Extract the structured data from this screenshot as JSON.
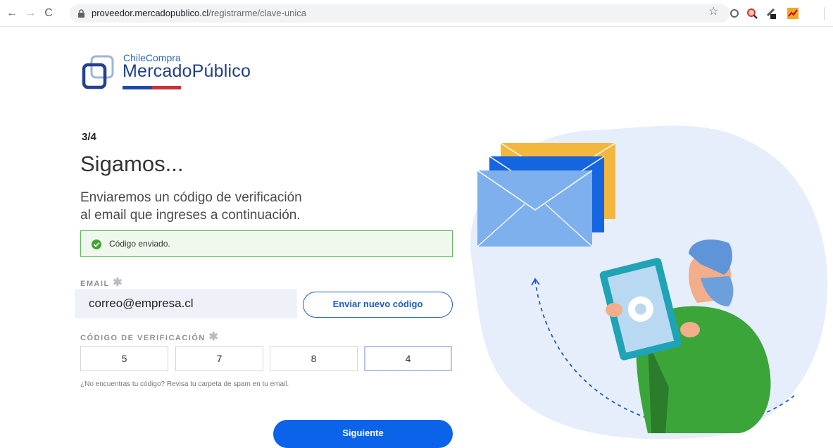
{
  "browser": {
    "url_host": "proveedor.mercadopublico.cl",
    "url_path": "/registrarme/clave-unica"
  },
  "logo": {
    "small": "ChileCompra",
    "big": "MercadoPúblico"
  },
  "form": {
    "step": "3/4",
    "title": "Sigamos...",
    "lead_line1": "Enviaremos un código de verificación",
    "lead_line2": "al email que ingreses a continuación.",
    "alert": "Código enviado.",
    "email_label": "EMAIL",
    "email_value": "correo@empresa.cl",
    "resend_label": "Enviar nuevo código",
    "code_label": "CÓDIGO DE VERIFICACIÓN",
    "required_mark": "✱",
    "code_digits": [
      "5",
      "7",
      "8",
      "4"
    ],
    "hint": "¿No encuentras tu código? Revisa tu carpeta de spam en tu email.",
    "next_label": "Siguiente"
  },
  "colors": {
    "primary": "#0a63e8",
    "success_border": "#5cb85c",
    "blob": "#e6eefb"
  }
}
